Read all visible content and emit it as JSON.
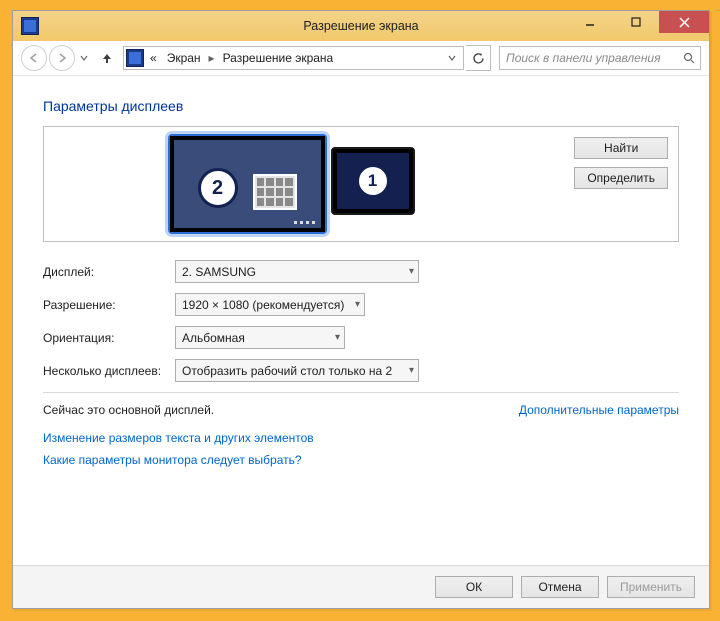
{
  "window": {
    "title": "Разрешение экрана"
  },
  "nav": {
    "path_prefix": "«",
    "crumb1": "Экран",
    "crumb2": "Разрешение экрана",
    "search_placeholder": "Поиск в панели управления"
  },
  "heading": "Параметры дисплеев",
  "side": {
    "find": "Найти",
    "identify": "Определить"
  },
  "monitors": {
    "primary_num": "2",
    "secondary_num": "1"
  },
  "form": {
    "display_label": "Дисплей:",
    "display_value": "2. SAMSUNG",
    "resolution_label": "Разрешение:",
    "resolution_value": "1920 × 1080 (рекомендуется)",
    "orientation_label": "Ориентация:",
    "orientation_value": "Альбомная",
    "multi_label": "Несколько дисплеев:",
    "multi_value": "Отобразить рабочий стол только на 2"
  },
  "status": {
    "main_display": "Сейчас это основной дисплей.",
    "advanced_link": "Дополнительные параметры"
  },
  "links": {
    "resize_text": "Изменение размеров текста и других элементов",
    "which_monitor": "Какие параметры монитора следует выбрать?"
  },
  "footer": {
    "ok": "ОК",
    "cancel": "Отмена",
    "apply": "Применить"
  }
}
